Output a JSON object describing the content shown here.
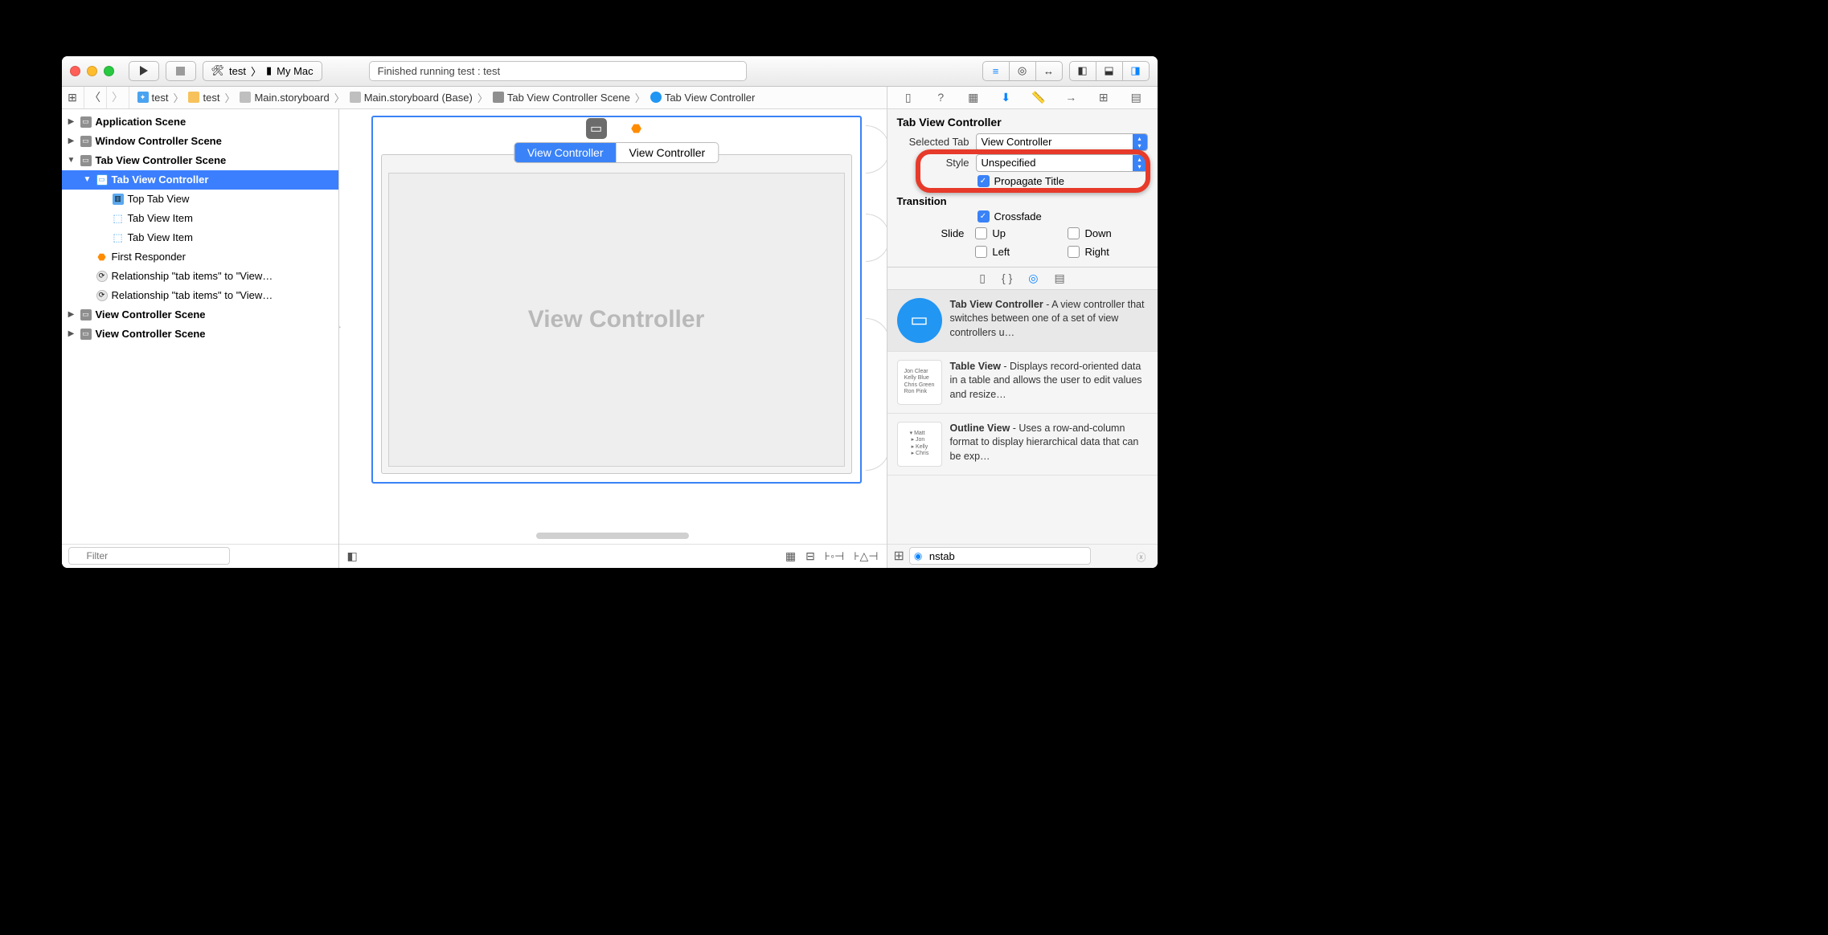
{
  "titlebar": {
    "scheme_name": "test",
    "scheme_dest": "My Mac",
    "status": "Finished running test : test"
  },
  "breadcrumbs": [
    {
      "icon": "swift-file",
      "label": "test"
    },
    {
      "icon": "folder",
      "label": "test"
    },
    {
      "icon": "storyboard",
      "label": "Main.storyboard"
    },
    {
      "icon": "storyboard",
      "label": "Main.storyboard (Base)"
    },
    {
      "icon": "scene",
      "label": "Tab View Controller Scene"
    },
    {
      "icon": "vc",
      "label": "Tab View Controller"
    }
  ],
  "outline": {
    "items": [
      {
        "indent": 0,
        "disc": "right",
        "icon": "scene",
        "label": "Application Scene",
        "bold": true
      },
      {
        "indent": 0,
        "disc": "right",
        "icon": "scene",
        "label": "Window Controller Scene",
        "bold": true
      },
      {
        "indent": 0,
        "disc": "down",
        "icon": "scene",
        "label": "Tab View Controller Scene",
        "bold": true
      },
      {
        "indent": 1,
        "disc": "down",
        "icon": "vc-square",
        "label": "Tab View Controller",
        "bold": true,
        "selected": true
      },
      {
        "indent": 2,
        "disc": "",
        "icon": "tabview",
        "label": "Top Tab View"
      },
      {
        "indent": 2,
        "disc": "",
        "icon": "cube",
        "label": "Tab View Item"
      },
      {
        "indent": 2,
        "disc": "",
        "icon": "cube",
        "label": "Tab View Item"
      },
      {
        "indent": 1,
        "disc": "",
        "icon": "orange",
        "label": "First Responder"
      },
      {
        "indent": 1,
        "disc": "",
        "icon": "rel",
        "label": "Relationship \"tab items\" to \"View…"
      },
      {
        "indent": 1,
        "disc": "",
        "icon": "rel",
        "label": "Relationship \"tab items\" to \"View…"
      },
      {
        "indent": 0,
        "disc": "right",
        "icon": "scene",
        "label": "View Controller Scene",
        "bold": true
      },
      {
        "indent": 0,
        "disc": "right",
        "icon": "scene",
        "label": "View Controller Scene",
        "bold": true
      }
    ],
    "filter_placeholder": "Filter"
  },
  "canvas": {
    "tab1": "View Controller",
    "tab2": "View Controller",
    "body_label": "View Controller"
  },
  "inspector": {
    "title": "Tab View Controller",
    "selected_tab": {
      "label": "Selected Tab",
      "value": "View Controller"
    },
    "style": {
      "label": "Style",
      "value": "Unspecified"
    },
    "propagate": {
      "label": "Propagate Title",
      "checked": true
    },
    "transition_title": "Transition",
    "crossfade": {
      "label": "Crossfade",
      "checked": true
    },
    "slide_label": "Slide",
    "dirs": {
      "up": "Up",
      "down": "Down",
      "left": "Left",
      "right": "Right"
    }
  },
  "library": {
    "items": [
      {
        "title": "Tab View Controller",
        "desc": " - A view controller that switches between one of a set of view controllers u…",
        "selected": true,
        "thumb": "blue"
      },
      {
        "title": "Table View",
        "desc": " - Displays record-oriented data in a table and allows the user to edit values and resize…",
        "thumb": "table"
      },
      {
        "title": "Outline View",
        "desc": " - Uses a row-and-column format to display hierarchical data that can be exp…",
        "thumb": "outline"
      }
    ],
    "search_value": "nstab"
  }
}
